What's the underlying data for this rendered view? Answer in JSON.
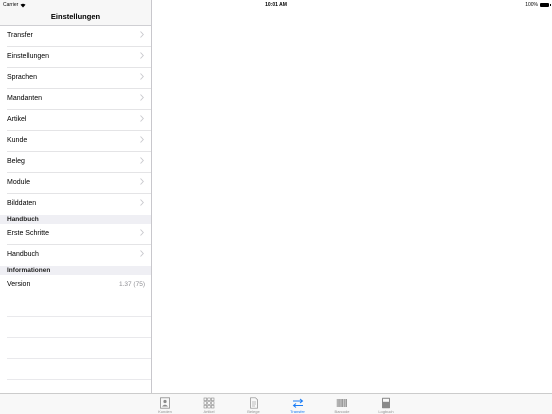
{
  "status_bar": {
    "carrier": "Carrier",
    "time": "10:01 AM",
    "battery": "100%"
  },
  "nav": {
    "title": "Einstellungen"
  },
  "sections": [
    {
      "header": "",
      "items": [
        {
          "label": "Transfer",
          "value": "",
          "chevron": true
        },
        {
          "label": "Einstellungen",
          "value": "",
          "chevron": true
        },
        {
          "label": "Sprachen",
          "value": "",
          "chevron": true
        },
        {
          "label": "Mandanten",
          "value": "",
          "chevron": true
        },
        {
          "label": "Artikel",
          "value": "",
          "chevron": true
        },
        {
          "label": "Kunde",
          "value": "",
          "chevron": true
        },
        {
          "label": "Beleg",
          "value": "",
          "chevron": true
        },
        {
          "label": "Module",
          "value": "",
          "chevron": true
        },
        {
          "label": "Bilddaten",
          "value": "",
          "chevron": true
        }
      ]
    },
    {
      "header": "Handbuch",
      "items": [
        {
          "label": "Erste Schritte",
          "value": "",
          "chevron": true
        },
        {
          "label": "Handbuch",
          "value": "",
          "chevron": true
        }
      ]
    },
    {
      "header": "Informationen",
      "items": [
        {
          "label": "Version",
          "value": "1.37 (75)",
          "chevron": false
        }
      ]
    }
  ],
  "tabs": [
    {
      "label": "Kunden",
      "icon": "contacts-icon",
      "active": false
    },
    {
      "label": "Artikel",
      "icon": "grid-icon",
      "active": false
    },
    {
      "label": "Belege",
      "icon": "document-icon",
      "active": false
    },
    {
      "label": "Transfer",
      "icon": "transfer-icon",
      "active": true
    },
    {
      "label": "Barcode",
      "icon": "barcode-icon",
      "active": false
    },
    {
      "label": "Logbuch",
      "icon": "logbook-icon",
      "active": false
    }
  ],
  "colors": {
    "accent": "#1a7cf5",
    "inactive": "#929292",
    "chevron": "#c7c7cc",
    "section_bg": "#efeff4"
  }
}
